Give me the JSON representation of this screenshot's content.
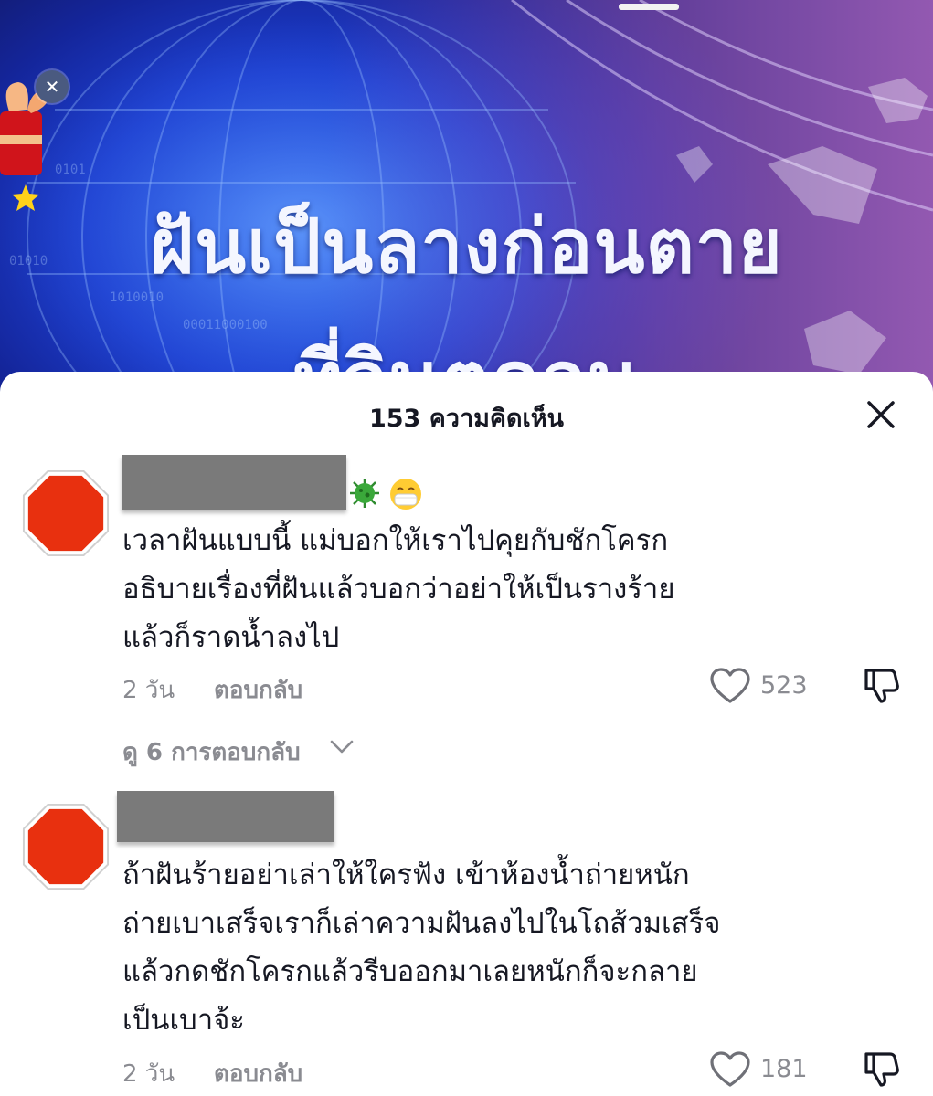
{
  "video": {
    "headline_line1": "ฝันเป็นลางก่อนตาย",
    "headline_line2": "ที่จินตคอน"
  },
  "sheet": {
    "title": "153 ความคิดเห็น"
  },
  "comments": [
    {
      "author": "",
      "author_emojis": [
        "virus-emoji",
        "mask-face-emoji"
      ],
      "text_lines": [
        "เวลาฝันแบบนี้ แม่บอกให้เราไปคุยกับชักโครก",
        "อธิบายเรื่องที่ฝันแล้วบอกว่าอย่าให้เป็นรางร้าย",
        "แล้วก็ราดน้ำลงไป"
      ],
      "time": "2 วัน",
      "reply_label": "ตอบกลับ",
      "likes": "523",
      "view_replies": "ดู 6 การตอบกลับ"
    },
    {
      "author": "",
      "text_lines": [
        "ถ้าฝันร้ายอย่าเล่าให้ใครฟัง เข้าห้องน้ำถ่ายหนัก",
        "ถ่ายเบาเสร็จเราก็เล่าความฝันลงไปในโถส้วมเสร็จ",
        "แล้วกดชักโครกแล้วรีบออกมาเลยหนักก็จะกลาย",
        "เป็นเบาจ้ะ"
      ],
      "time": "2 วัน",
      "reply_label": "ตอบกลับ",
      "likes": "181"
    }
  ],
  "colors": {
    "avatar_red": "#e8300f",
    "muted_text": "#8a8b91",
    "primary_text": "#161823"
  }
}
